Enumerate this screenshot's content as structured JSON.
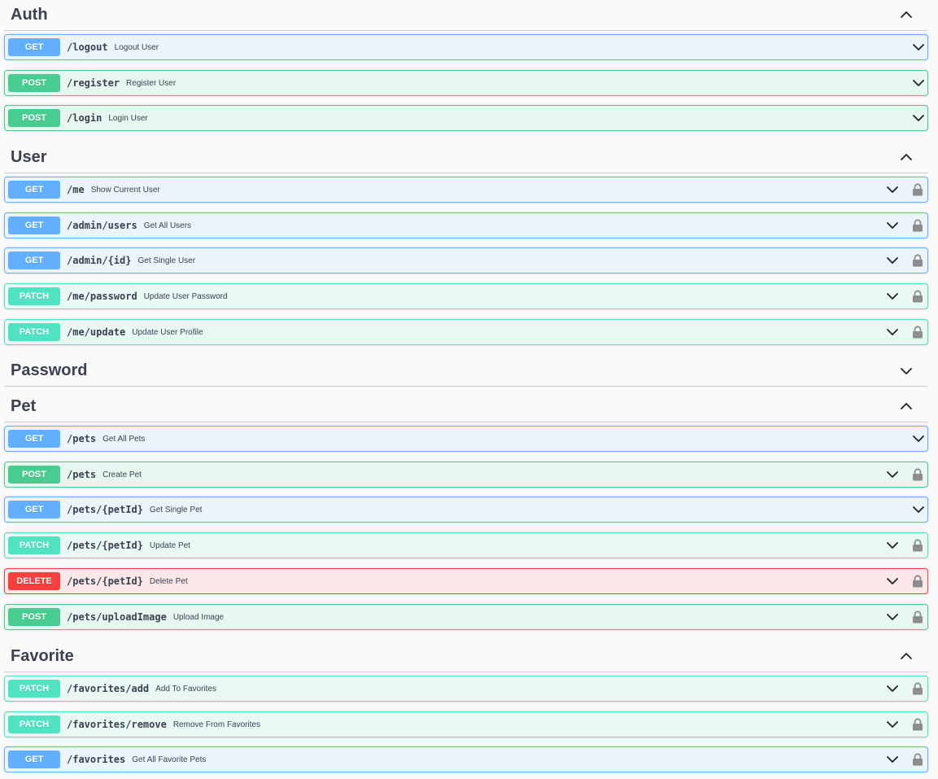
{
  "colors": {
    "get": "#61affe",
    "post": "#49cc90",
    "patch": "#50e3c2",
    "delete": "#f93e3e"
  },
  "sections": [
    {
      "name": "Auth",
      "expanded": true,
      "operations": [
        {
          "method": "GET",
          "path": "/logout",
          "summary": "Logout User",
          "locked": false
        },
        {
          "method": "POST",
          "path": "/register",
          "summary": "Register User",
          "locked": false
        },
        {
          "method": "POST",
          "path": "/login",
          "summary": "Login User",
          "locked": false
        }
      ]
    },
    {
      "name": "User",
      "expanded": true,
      "operations": [
        {
          "method": "GET",
          "path": "/me",
          "summary": "Show Current User",
          "locked": true
        },
        {
          "method": "GET",
          "path": "/admin/users",
          "summary": "Get All Users",
          "locked": true
        },
        {
          "method": "GET",
          "path": "/admin/{id}",
          "summary": "Get Single User",
          "locked": true
        },
        {
          "method": "PATCH",
          "path": "/me/password",
          "summary": "Update User Password",
          "locked": true
        },
        {
          "method": "PATCH",
          "path": "/me/update",
          "summary": "Update User Profile",
          "locked": true
        }
      ]
    },
    {
      "name": "Password",
      "expanded": false,
      "operations": []
    },
    {
      "name": "Pet",
      "expanded": true,
      "operations": [
        {
          "method": "GET",
          "path": "/pets",
          "summary": "Get All Pets",
          "locked": false
        },
        {
          "method": "POST",
          "path": "/pets",
          "summary": "Create Pet",
          "locked": true
        },
        {
          "method": "GET",
          "path": "/pets/{petId}",
          "summary": "Get Single Pet",
          "locked": false
        },
        {
          "method": "PATCH",
          "path": "/pets/{petId}",
          "summary": "Update Pet",
          "locked": true
        },
        {
          "method": "DELETE",
          "path": "/pets/{petId}",
          "summary": "Delete Pet",
          "locked": true
        },
        {
          "method": "POST",
          "path": "/pets/uploadImage",
          "summary": "Upload Image",
          "locked": true
        }
      ]
    },
    {
      "name": "Favorite",
      "expanded": true,
      "operations": [
        {
          "method": "PATCH",
          "path": "/favorites/add",
          "summary": "Add To Favorites",
          "locked": true
        },
        {
          "method": "PATCH",
          "path": "/favorites/remove",
          "summary": "Remove From Favorites",
          "locked": true
        },
        {
          "method": "GET",
          "path": "/favorites",
          "summary": "Get All Favorite Pets",
          "locked": true
        }
      ]
    }
  ]
}
